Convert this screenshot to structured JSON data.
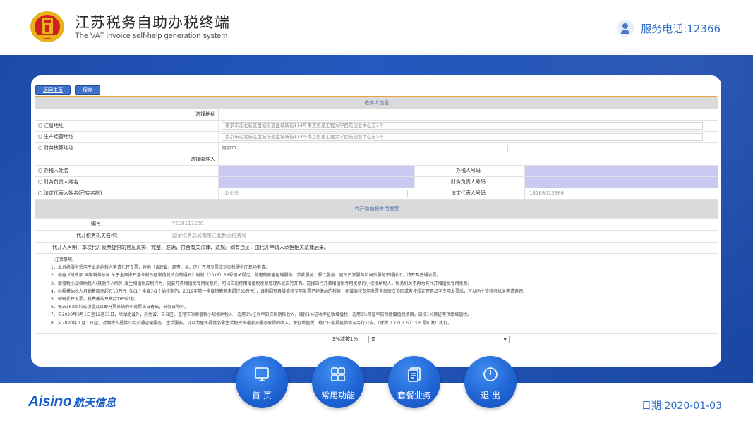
{
  "header": {
    "title_cn": "江苏税务自助办税终端",
    "title_en": "The VAT invoice self-help generation system",
    "phone": "服务电话:12366"
  },
  "toolbar": {
    "home_label": "返回主页",
    "save_label": "保存"
  },
  "recipient": {
    "section_title": "收件人信息",
    "choose_address": "选择地址",
    "addresses": [
      {
        "label": "注册地址",
        "value": "南京市江北新区盘城街道盘城新街114号南京信息工程大学西苑创业中心东1号"
      },
      {
        "label": "生产经营地址",
        "value": "南京市江北新区盘城街道盘城新街114号南京信息工程大学西苑创业中心东1号"
      },
      {
        "label": "财务核算地址",
        "value": "南京市"
      }
    ],
    "choose_recipient": "选择收件人",
    "persons": [
      {
        "label": "办税人姓名",
        "value": "",
        "phone_label": "办税人号码",
        "phone": ""
      },
      {
        "label": "财务负责人姓名",
        "value": "",
        "phone_label": "财务负责人号码",
        "phone": ""
      },
      {
        "label": "法定代表人姓名(已实名制)",
        "value": "赵川云",
        "phone_label": "法定代表人号码",
        "phone": "18168013886"
      }
    ]
  },
  "invoice": {
    "section_title": "代开增值税专用发票",
    "number_label": "编号：",
    "number_value": "Y200117268",
    "office_label": "代开税务机关名称：",
    "office_value": "国家税务总局南京江北新区税务局",
    "declaration": "代开人声明：本次代开发票提供的信息真实、完整、准确，符合有关法律、法规。如有违反，由代开申请人承担相关法律后果。"
  },
  "notes": {
    "title": "【注意事项】",
    "items": [
      "1、本系统服务适用于本地纳税人申请代开专票，异地（含跨省、跨市、县、区）开具专票应到办税服务厅现场申请。",
      "2、根据《财政部 国家税务总局 关于全面推开营业税改征增值税试点的通知》财税〔2016〕36号相关规定，购进的旅客运输服务、贷款服务、餐饮服务、居民日常服务和娱乐服务不得抵扣，请开具普通发票。",
      "3、增值税小规模纳税人(其他个人除外)发生增值税应税行为，需要开具增值税专用发票的，可以自愿使用增值税发票管理系统自行开具。选择自行开具增值税专用发票的小规模纳税人，税务机关不再为其代开增值税专用发票。",
      "4、小规模纳税人月销售额未超过10万元（以1个季度为1个纳税期的，2019年第一季度销售额未超过30万元），当期因开具增值税专用发票已经缴纳的税款，在增值税专用发票全部联次追回或者按规定开具红字专用发票后，可以向主管税务机关申请退还。",
      "5、邮寄代开发票，税费缴纳只支持TIPS扣款。",
      "6、每天16:00前成功提交且即开票系统的申请票当日寄出，节假日除外。",
      "7、自2020年3月1日至12月31日，除湖北省外，其他省、自治区、直辖市的增值税小规模纳税人，适用3%征收率的应税销售收入，减按1%征收率征收增值税；适用3%预征率的预缴增值税项目，减按1%预征率预缴增值税。",
      "8、自2020年１月１日起，对纳税人提供公共交通运输服务、生活服务，以及为居民提供必需生活物资快递收派服务取得的收入，免征增值税，截止日期视疫情情况另行公告。（财税〔２０１６〕３６号印发）执行。"
    ]
  },
  "reduce": {
    "label": "3%减按1%：",
    "value": "是"
  },
  "nav": [
    {
      "label": "首 页",
      "icon": "monitor-icon"
    },
    {
      "label": "常用功能",
      "icon": "grid-icon"
    },
    {
      "label": "套餐业务",
      "icon": "document-icon"
    },
    {
      "label": "退 出",
      "icon": "power-icon"
    }
  ],
  "footer": {
    "brand_en": "Aisino",
    "brand_cn": "航天信息",
    "date": "日期:2020-01-03"
  },
  "colors": {
    "band": "#1d4fb0",
    "accent": "#2f6dc4",
    "section_bar": "#dadada",
    "purple_field": "#c9c9f2",
    "orange_line": "#e4a33d"
  }
}
